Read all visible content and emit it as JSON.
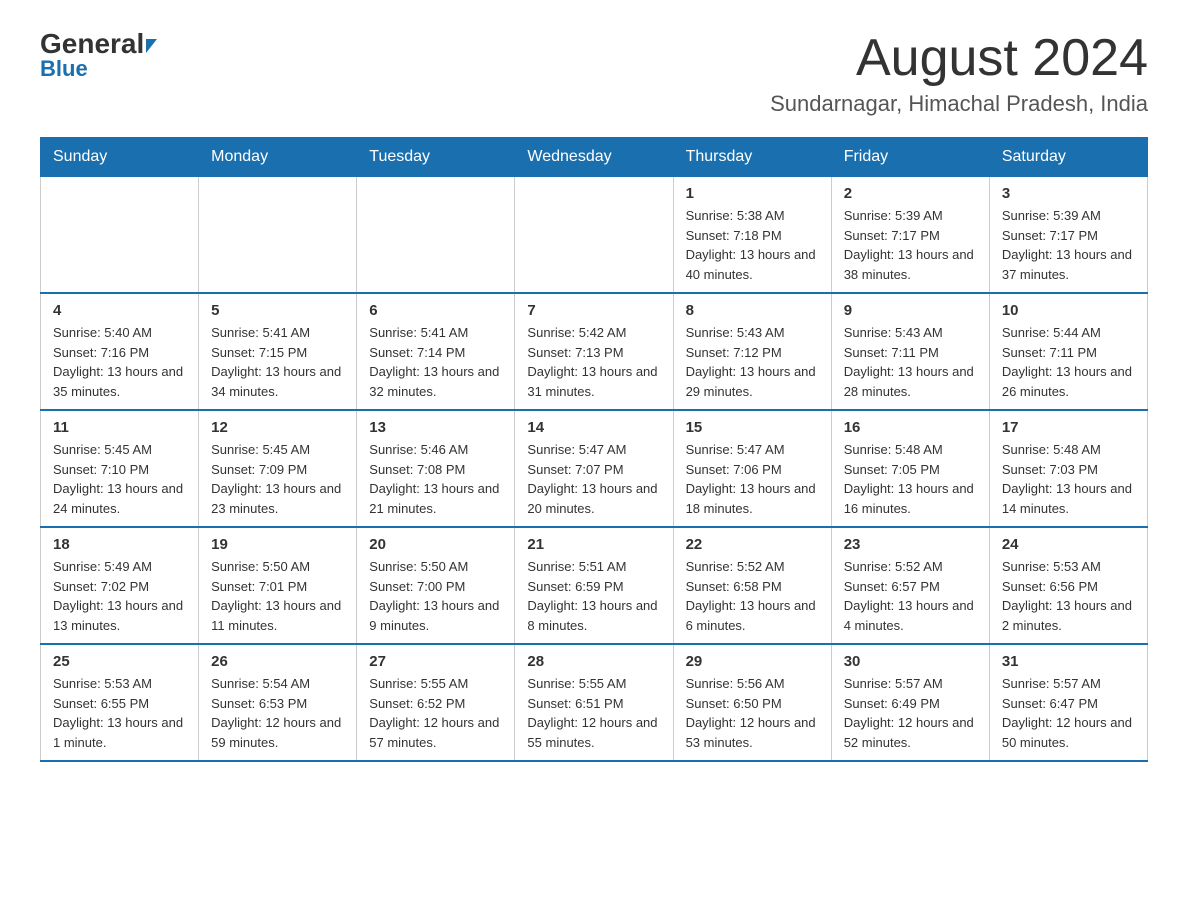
{
  "header": {
    "logo_general": "General",
    "logo_blue": "Blue",
    "main_title": "August 2024",
    "subtitle": "Sundarnagar, Himachal Pradesh, India"
  },
  "days_of_week": [
    "Sunday",
    "Monday",
    "Tuesday",
    "Wednesday",
    "Thursday",
    "Friday",
    "Saturday"
  ],
  "weeks": [
    [
      {
        "day": "",
        "info": ""
      },
      {
        "day": "",
        "info": ""
      },
      {
        "day": "",
        "info": ""
      },
      {
        "day": "",
        "info": ""
      },
      {
        "day": "1",
        "info": "Sunrise: 5:38 AM\nSunset: 7:18 PM\nDaylight: 13 hours and 40 minutes."
      },
      {
        "day": "2",
        "info": "Sunrise: 5:39 AM\nSunset: 7:17 PM\nDaylight: 13 hours and 38 minutes."
      },
      {
        "day": "3",
        "info": "Sunrise: 5:39 AM\nSunset: 7:17 PM\nDaylight: 13 hours and 37 minutes."
      }
    ],
    [
      {
        "day": "4",
        "info": "Sunrise: 5:40 AM\nSunset: 7:16 PM\nDaylight: 13 hours and 35 minutes."
      },
      {
        "day": "5",
        "info": "Sunrise: 5:41 AM\nSunset: 7:15 PM\nDaylight: 13 hours and 34 minutes."
      },
      {
        "day": "6",
        "info": "Sunrise: 5:41 AM\nSunset: 7:14 PM\nDaylight: 13 hours and 32 minutes."
      },
      {
        "day": "7",
        "info": "Sunrise: 5:42 AM\nSunset: 7:13 PM\nDaylight: 13 hours and 31 minutes."
      },
      {
        "day": "8",
        "info": "Sunrise: 5:43 AM\nSunset: 7:12 PM\nDaylight: 13 hours and 29 minutes."
      },
      {
        "day": "9",
        "info": "Sunrise: 5:43 AM\nSunset: 7:11 PM\nDaylight: 13 hours and 28 minutes."
      },
      {
        "day": "10",
        "info": "Sunrise: 5:44 AM\nSunset: 7:11 PM\nDaylight: 13 hours and 26 minutes."
      }
    ],
    [
      {
        "day": "11",
        "info": "Sunrise: 5:45 AM\nSunset: 7:10 PM\nDaylight: 13 hours and 24 minutes."
      },
      {
        "day": "12",
        "info": "Sunrise: 5:45 AM\nSunset: 7:09 PM\nDaylight: 13 hours and 23 minutes."
      },
      {
        "day": "13",
        "info": "Sunrise: 5:46 AM\nSunset: 7:08 PM\nDaylight: 13 hours and 21 minutes."
      },
      {
        "day": "14",
        "info": "Sunrise: 5:47 AM\nSunset: 7:07 PM\nDaylight: 13 hours and 20 minutes."
      },
      {
        "day": "15",
        "info": "Sunrise: 5:47 AM\nSunset: 7:06 PM\nDaylight: 13 hours and 18 minutes."
      },
      {
        "day": "16",
        "info": "Sunrise: 5:48 AM\nSunset: 7:05 PM\nDaylight: 13 hours and 16 minutes."
      },
      {
        "day": "17",
        "info": "Sunrise: 5:48 AM\nSunset: 7:03 PM\nDaylight: 13 hours and 14 minutes."
      }
    ],
    [
      {
        "day": "18",
        "info": "Sunrise: 5:49 AM\nSunset: 7:02 PM\nDaylight: 13 hours and 13 minutes."
      },
      {
        "day": "19",
        "info": "Sunrise: 5:50 AM\nSunset: 7:01 PM\nDaylight: 13 hours and 11 minutes."
      },
      {
        "day": "20",
        "info": "Sunrise: 5:50 AM\nSunset: 7:00 PM\nDaylight: 13 hours and 9 minutes."
      },
      {
        "day": "21",
        "info": "Sunrise: 5:51 AM\nSunset: 6:59 PM\nDaylight: 13 hours and 8 minutes."
      },
      {
        "day": "22",
        "info": "Sunrise: 5:52 AM\nSunset: 6:58 PM\nDaylight: 13 hours and 6 minutes."
      },
      {
        "day": "23",
        "info": "Sunrise: 5:52 AM\nSunset: 6:57 PM\nDaylight: 13 hours and 4 minutes."
      },
      {
        "day": "24",
        "info": "Sunrise: 5:53 AM\nSunset: 6:56 PM\nDaylight: 13 hours and 2 minutes."
      }
    ],
    [
      {
        "day": "25",
        "info": "Sunrise: 5:53 AM\nSunset: 6:55 PM\nDaylight: 13 hours and 1 minute."
      },
      {
        "day": "26",
        "info": "Sunrise: 5:54 AM\nSunset: 6:53 PM\nDaylight: 12 hours and 59 minutes."
      },
      {
        "day": "27",
        "info": "Sunrise: 5:55 AM\nSunset: 6:52 PM\nDaylight: 12 hours and 57 minutes."
      },
      {
        "day": "28",
        "info": "Sunrise: 5:55 AM\nSunset: 6:51 PM\nDaylight: 12 hours and 55 minutes."
      },
      {
        "day": "29",
        "info": "Sunrise: 5:56 AM\nSunset: 6:50 PM\nDaylight: 12 hours and 53 minutes."
      },
      {
        "day": "30",
        "info": "Sunrise: 5:57 AM\nSunset: 6:49 PM\nDaylight: 12 hours and 52 minutes."
      },
      {
        "day": "31",
        "info": "Sunrise: 5:57 AM\nSunset: 6:47 PM\nDaylight: 12 hours and 50 minutes."
      }
    ]
  ]
}
